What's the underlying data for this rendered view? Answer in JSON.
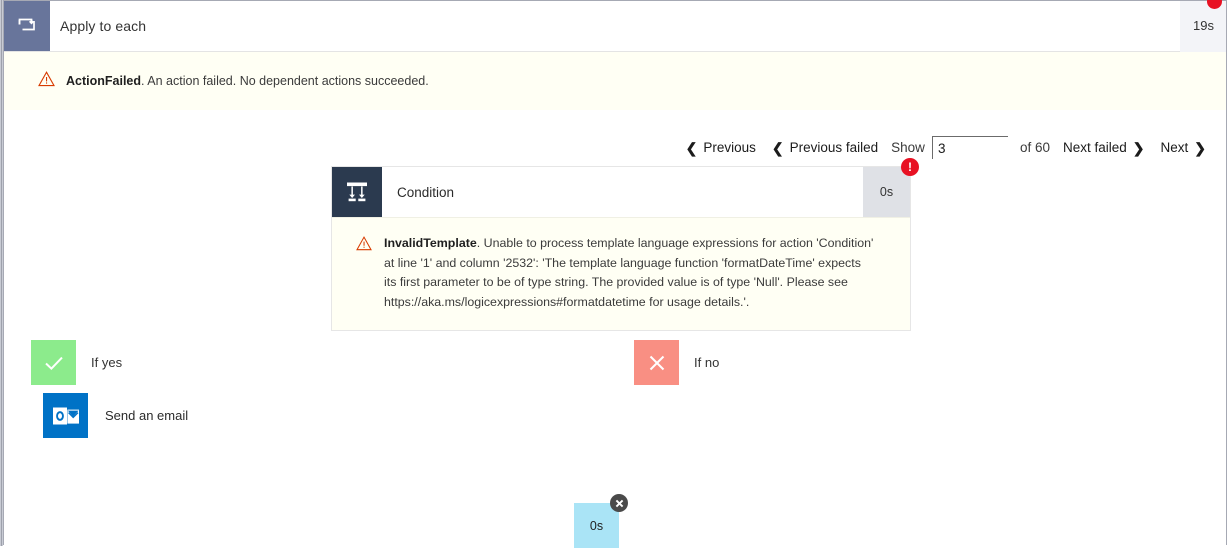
{
  "window": {
    "title": "Apply to each",
    "icon": "loop-repeat-icon",
    "duration": "19s"
  },
  "error_banner": {
    "icon": "warning-triangle-icon",
    "code": "ActionFailed",
    "message": ". An action failed. No dependent actions succeeded."
  },
  "pager": {
    "previous_label": "Previous",
    "previous_failed_label": "Previous failed",
    "show_label": "Show",
    "show_value": "3",
    "show_placeholder": "",
    "of_label": "of 60",
    "next_failed_label": "Next failed",
    "next_label": "Next",
    "chevron_left": "❮",
    "chevron_right": "❯"
  },
  "condition_card": {
    "icon": "condition-branch-icon",
    "title": "Condition",
    "duration": "0s",
    "badge": "!",
    "error": {
      "icon": "warning-triangle-icon",
      "code": "InvalidTemplate",
      "message": ". Unable to process template language expressions for action 'Condition' at line '1' and column '2532': 'The template language function 'formatDateTime' expects its first parameter to be of type string. The provided value is of type 'Null'. Please see https://aka.ms/logicexpressions#formatdatetime for usage details.'."
    }
  },
  "branches": {
    "yes": {
      "icon": "checkmark-icon",
      "label": "If yes",
      "color": "#8ceb8c"
    },
    "no": {
      "icon": "cross-icon",
      "label": "If no",
      "color": "#f98f83"
    }
  },
  "email_node": {
    "icon": "outlook-icon",
    "label": "Send an email",
    "duration": "0s",
    "badge_icon": "cancel-circle-icon",
    "duration_color": "#aae4f6"
  },
  "colors": {
    "titlebar_icon_bg": "#68759b",
    "error_bg": "#fffff4",
    "error_accent": "#e81123",
    "condition_icon_bg": "#2b3a4f",
    "outlook_blue": "#0072c6"
  }
}
